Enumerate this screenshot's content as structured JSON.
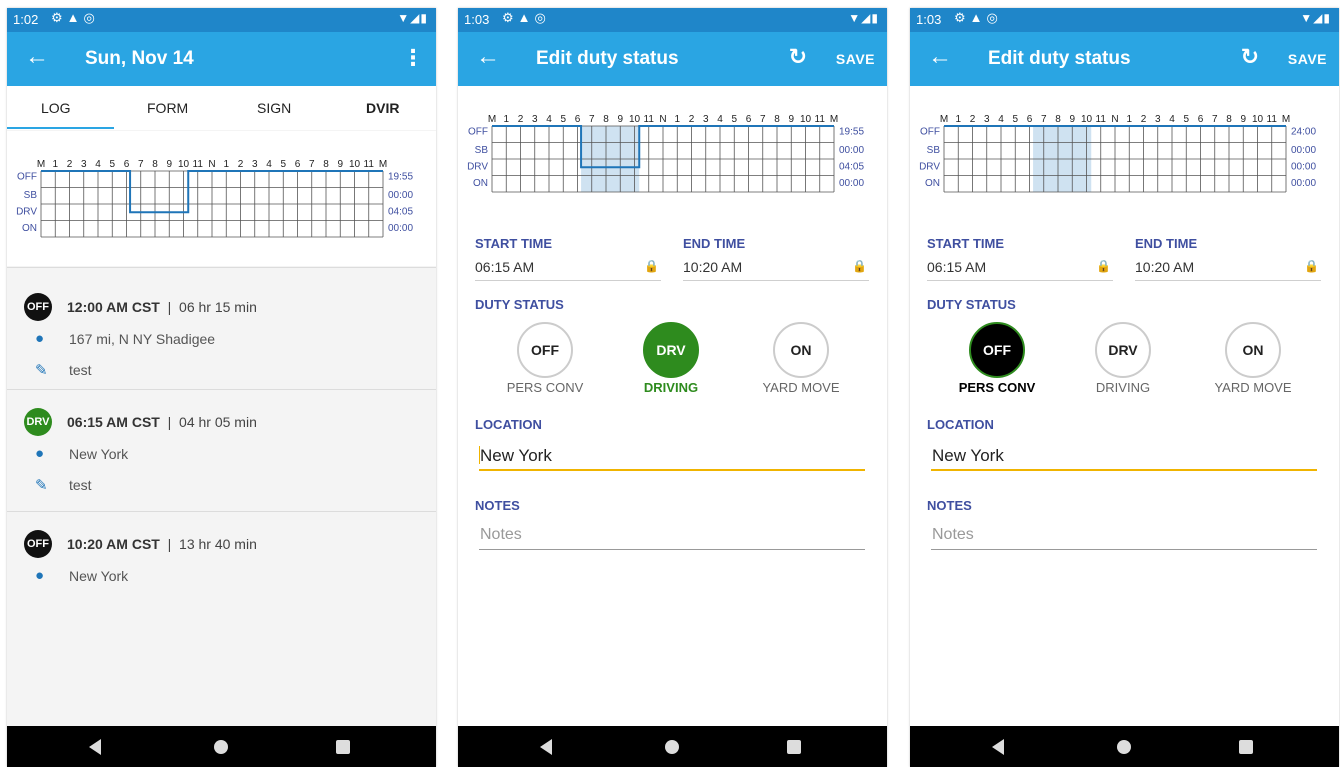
{
  "colors": {
    "statusbar": "#1f86c9",
    "appbar": "#2aa5e3",
    "label": "#3f4fa0",
    "drv_green": "#2e8b1e",
    "graph_line": "#1f75b8",
    "focus_line": "#f0b400"
  },
  "icons": {
    "back": "arrow-left-icon",
    "menu": "more-vert-icon",
    "refresh": "refresh-icon",
    "location": "map-pin-icon",
    "note": "pencil-icon",
    "lock": "lock-icon"
  },
  "screens": [
    {
      "status": {
        "time": "1:02"
      },
      "appbar": {
        "title": "Sun, Nov 14"
      },
      "tabs": [
        "LOG",
        "FORM",
        "SIGN",
        "DVIR"
      ],
      "graph": {
        "hours": [
          "M",
          "1",
          "2",
          "3",
          "4",
          "5",
          "6",
          "7",
          "8",
          "9",
          "10",
          "11",
          "N",
          "1",
          "2",
          "3",
          "4",
          "5",
          "6",
          "7",
          "8",
          "9",
          "10",
          "11",
          "M"
        ],
        "rows": [
          "OFF",
          "SB",
          "DRV",
          "ON"
        ],
        "totals": [
          "19:55",
          "00:00",
          "04:05",
          "00:00"
        ],
        "segments": [
          {
            "status": "OFF",
            "start": 0,
            "end": 6.25
          },
          {
            "status": "DRV",
            "start": 6.25,
            "end": 10.333
          },
          {
            "status": "OFF",
            "start": 10.333,
            "end": 24
          }
        ],
        "highlight": null
      },
      "entries": [
        {
          "badge": "OFF",
          "time": "12:00 AM CST",
          "duration": "06 hr  15 min",
          "location": "167 mi, N NY Shadigee",
          "note": "test"
        },
        {
          "badge": "DRV",
          "time": "06:15 AM CST",
          "duration": "04 hr  05 min",
          "location": "New York",
          "note": "test"
        },
        {
          "badge": "OFF",
          "time": "10:20 AM CST",
          "duration": "13 hr  40 min",
          "location": "New York"
        }
      ]
    },
    {
      "status": {
        "time": "1:03"
      },
      "appbar": {
        "title": "Edit duty status",
        "save": "SAVE"
      },
      "graph": {
        "hours": [
          "M",
          "1",
          "2",
          "3",
          "4",
          "5",
          "6",
          "7",
          "8",
          "9",
          "10",
          "11",
          "N",
          "1",
          "2",
          "3",
          "4",
          "5",
          "6",
          "7",
          "8",
          "9",
          "10",
          "11",
          "M"
        ],
        "rows": [
          "OFF",
          "SB",
          "DRV",
          "ON"
        ],
        "totals": [
          "19:55",
          "00:00",
          "04:05",
          "00:00"
        ],
        "segments": [
          {
            "status": "OFF",
            "start": 0,
            "end": 6.25
          },
          {
            "status": "DRV",
            "start": 6.25,
            "end": 10.333
          },
          {
            "status": "OFF",
            "start": 10.333,
            "end": 24
          }
        ],
        "highlight": [
          6.25,
          10.333
        ]
      },
      "form": {
        "start_label": "START TIME",
        "start_value": "06:15 AM",
        "end_label": "END TIME",
        "end_value": "10:20 AM",
        "duty_label": "DUTY STATUS",
        "options": [
          {
            "code": "OFF",
            "label": "PERS CONV",
            "selected": false
          },
          {
            "code": "DRV",
            "label": "DRIVING",
            "selected": true
          },
          {
            "code": "ON",
            "label": "YARD MOVE",
            "selected": false
          }
        ],
        "location_label": "LOCATION",
        "location_value": "New York",
        "notes_label": "NOTES",
        "notes_placeholder": "Notes"
      }
    },
    {
      "status": {
        "time": "1:03"
      },
      "appbar": {
        "title": "Edit duty status",
        "save": "SAVE"
      },
      "graph": {
        "hours": [
          "M",
          "1",
          "2",
          "3",
          "4",
          "5",
          "6",
          "7",
          "8",
          "9",
          "10",
          "11",
          "N",
          "1",
          "2",
          "3",
          "4",
          "5",
          "6",
          "7",
          "8",
          "9",
          "10",
          "11",
          "M"
        ],
        "rows": [
          "OFF",
          "SB",
          "DRV",
          "ON"
        ],
        "totals": [
          "24:00",
          "00:00",
          "00:00",
          "00:00"
        ],
        "segments": [
          {
            "status": "OFF",
            "start": 0,
            "end": 24
          }
        ],
        "highlight": [
          6.25,
          10.333
        ]
      },
      "form": {
        "start_label": "START TIME",
        "start_value": "06:15 AM",
        "end_label": "END TIME",
        "end_value": "10:20 AM",
        "duty_label": "DUTY STATUS",
        "options": [
          {
            "code": "OFF",
            "label": "PERS CONV",
            "selected": true
          },
          {
            "code": "DRV",
            "label": "DRIVING",
            "selected": false
          },
          {
            "code": "ON",
            "label": "YARD MOVE",
            "selected": false
          }
        ],
        "location_label": "LOCATION",
        "location_value": "New York",
        "notes_label": "NOTES",
        "notes_placeholder": "Notes"
      }
    }
  ]
}
